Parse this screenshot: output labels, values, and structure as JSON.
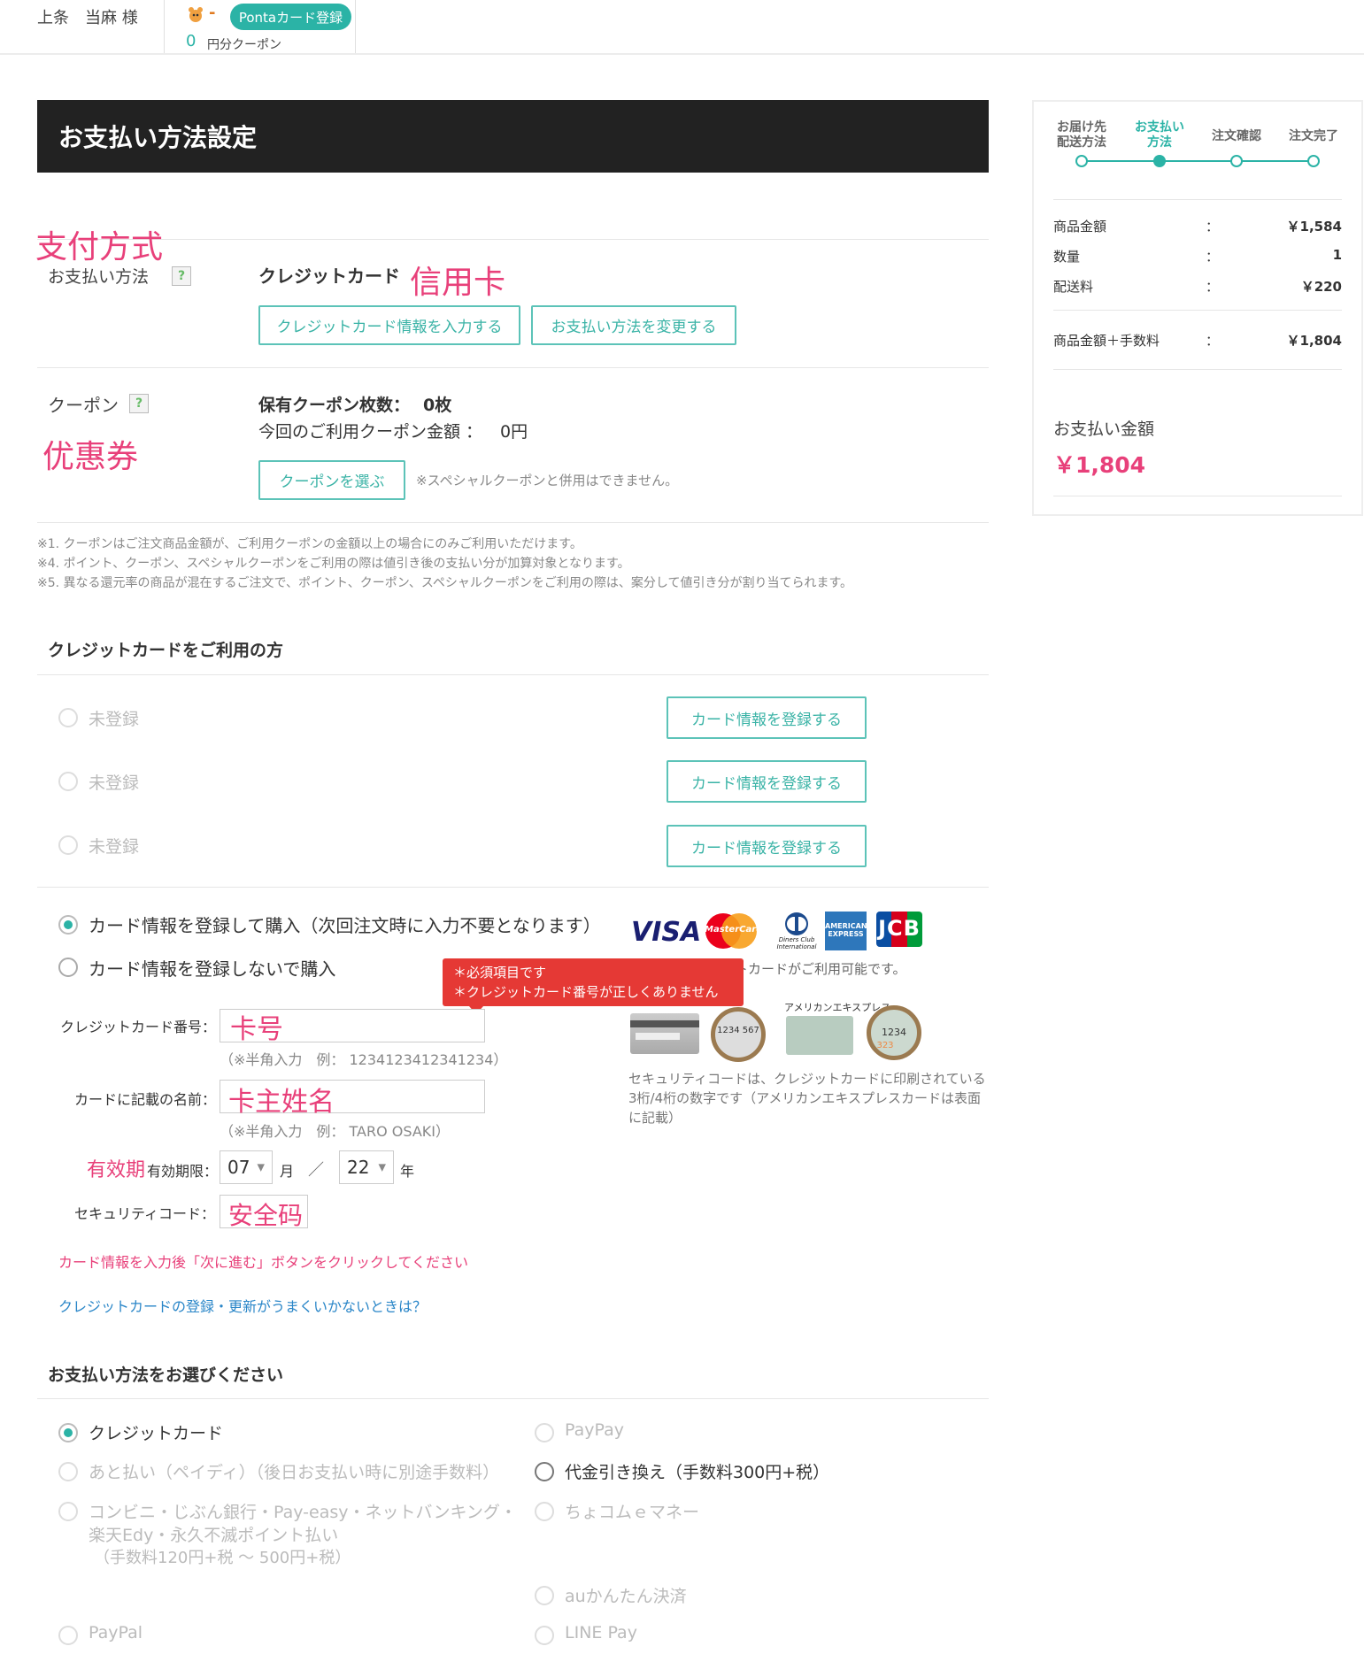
{
  "header": {
    "user_name": "上条　当麻 様",
    "ponta_dash": "-",
    "ponta_button": "Pontaカード登録",
    "coupon_count": "0",
    "coupon_unit": "円分クーポン"
  },
  "page_title": "お支払い方法設定",
  "payment_method": {
    "annotation_cn": "支付方式",
    "label": "お支払い方法",
    "help": "?",
    "value": "クレジットカード",
    "value_annotation_cn": "信用卡",
    "btn_enter_card": "クレジットカード情報を入力する",
    "btn_change_method": "お支払い方法を変更する"
  },
  "coupon": {
    "label": "クーポン",
    "help": "?",
    "annotation_cn": "优惠券",
    "owned_label": "保有クーポン枚数：",
    "owned_value": "0枚",
    "use_amount_label": "今回のご利用クーポン金額 ：",
    "use_amount_value": "0円",
    "btn_choose": "クーポンを選ぶ",
    "note": "※スペシャルクーポンと併用はできません。"
  },
  "notes": [
    "※1. クーポンはご注文商品金額が、ご利用クーポンの金額以上の場合にのみご利用いただけます。",
    "※4. ポイント、クーポン、スペシャルクーポンをご利用の際は値引き後の支払い分が加算対象となります。",
    "※5. 異なる還元率の商品が混在するご注文で、ポイント、クーポン、スペシャルクーポンをご利用の際は、案分して値引き分が割り当てられます。"
  ],
  "credit_section": {
    "title": "クレジットカードをご利用の方",
    "saved_cards": [
      {
        "label": "未登録",
        "button": "カード情報を登録する"
      },
      {
        "label": "未登録",
        "button": "カード情報を登録する"
      },
      {
        "label": "未登録",
        "button": "カード情報を登録する"
      }
    ],
    "option_register": "カード情報を登録して購入（次回注文時に入力不要となります）",
    "option_no_register": "カード情報を登録しないで購入",
    "brands": [
      "VISA",
      "MasterCard",
      "Diners Club International",
      "AMERICAN EXPRESS",
      "JCB"
    ],
    "available_note": "こちらのクレジットカードがご利用可能です。",
    "error_lines": [
      "＊必須項目です",
      "＊クレジットカード番号が正しくありません"
    ],
    "card_number_label": "クレジットカード番号：",
    "card_number_annotation": "卡号",
    "card_number_hint": "（※半角入力　例： 1234123412341234）",
    "name_label": "カードに記載の名前：",
    "name_annotation": "卡主姓名",
    "name_hint": "（※半角入力　例： TARO OSAKI）",
    "expiry_annotation": "有效期",
    "expiry_label": "有効期限：",
    "expiry_month": "07",
    "month_unit": "月",
    "slash": "／",
    "expiry_year": "22",
    "year_unit": "年",
    "security_label": "セキュリティコード：",
    "security_annotation": "安全码",
    "amex_label": "アメリカンエキスプレス",
    "card_digits_back": "1234 567",
    "card_digits_amex": "1234",
    "card_digits_amex2": "323",
    "security_note": "セキュリティコードは、クレジットカードに印刷されている3桁/4桁の数字です（アメリカンエキスプレスカードは表面に記載）",
    "instruction": "カード情報を入力後「次に進む」ボタンをクリックしてください",
    "help_link": "クレジットカードの登録・更新がうまくいかないときは？"
  },
  "method_section": {
    "title": "お支払い方法をお選びください",
    "left_options": [
      "クレジットカード",
      "あと払い（ペイディ）（後日お支払い時に別途手数料）",
      "コンビニ・じぶん銀行・Pay-easy・ネットバンキング・",
      "楽天Edy・永久不滅ポイント払い",
      "（手数料120円+税 ～ 500円+税）",
      "PayPal"
    ],
    "right_options": [
      "PayPay",
      "代金引き換え（手数料300円+税）",
      "ちょコムｅマネー",
      "auかんたん決済",
      "LINE Pay"
    ]
  },
  "sidebar": {
    "steps": [
      {
        "line1": "お届け先",
        "line2": "配送方法"
      },
      {
        "line1": "お支払い",
        "line2": "方法"
      },
      {
        "line1": "注文確認",
        "line2": ""
      },
      {
        "line1": "注文完了",
        "line2": ""
      }
    ],
    "rows": [
      {
        "label": "商品金額",
        "sep": "：",
        "value": "￥1,584"
      },
      {
        "label": "数量",
        "sep": "：",
        "value": "1"
      },
      {
        "label": "配送料",
        "sep": "：",
        "value": "￥220"
      },
      {
        "label": "商品金額＋手数料",
        "sep": "：",
        "value": "￥1,804"
      }
    ],
    "total_label": "お支払い金額",
    "total_value": "￥1,804"
  },
  "colors": {
    "accent": "#2bb3a6",
    "annotation": "#e8407a",
    "error": "#e53935",
    "title_bar": "#222222"
  }
}
